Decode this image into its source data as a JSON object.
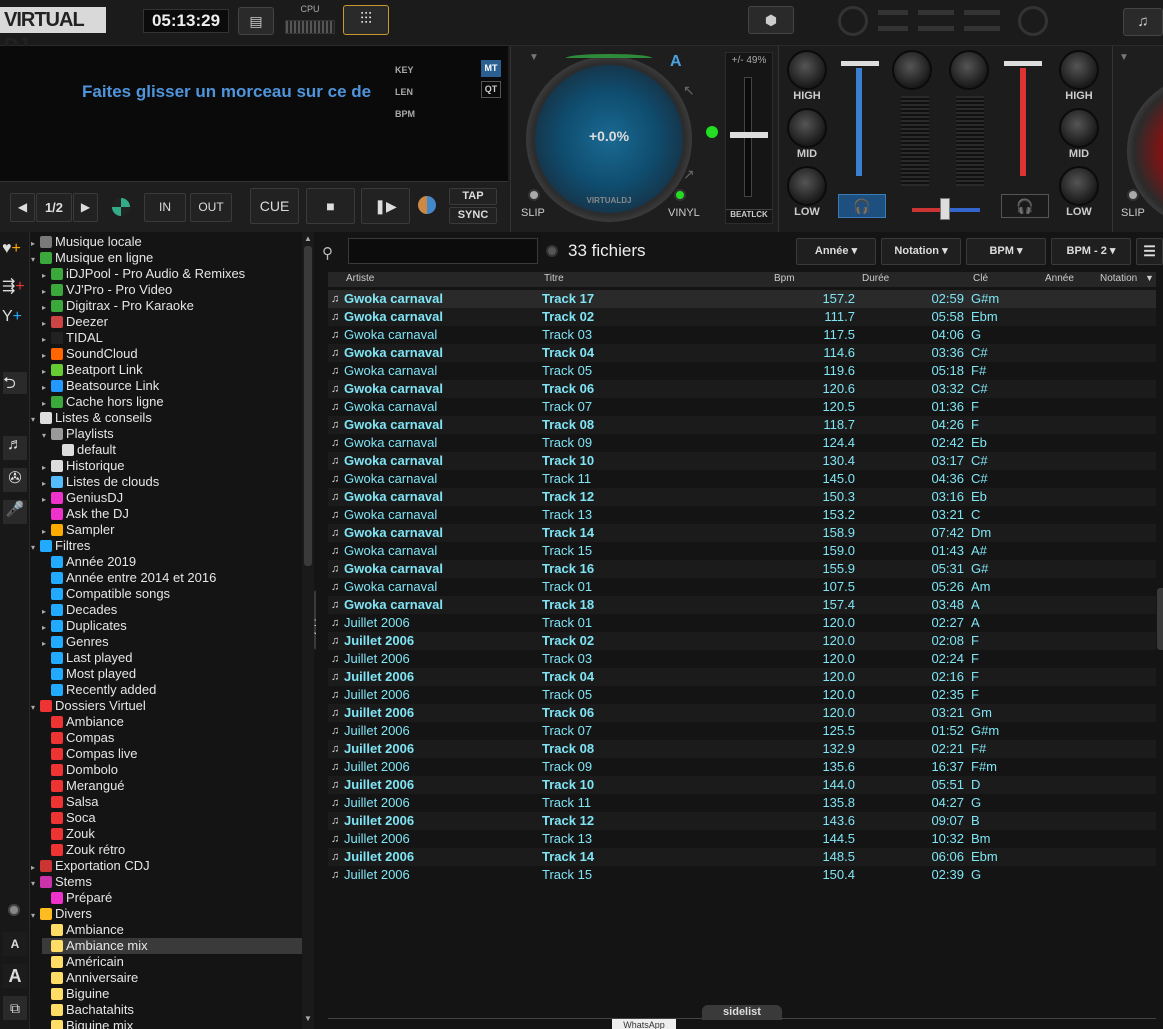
{
  "topbar": {
    "logo": "VIRTUAL DJ",
    "clock": "05:13:29",
    "cpu_label": "CPU"
  },
  "deckA": {
    "drop_message": "Faites glisser un morceau sur ce de",
    "key_label": "KEY",
    "len_label": "LEN",
    "bpm_label": "BPM",
    "mt": "MT",
    "qt": "QT",
    "page": "1/2",
    "in": "IN",
    "out": "OUT",
    "cue": "CUE",
    "tap": "TAP",
    "sync": "SYNC",
    "pitch": "+0.0%",
    "deck_letter": "A",
    "slip": "SLIP",
    "vinyl": "VINYL",
    "range": "+/- 49%",
    "beatlock": "BEATLCK",
    "brand": "VIRTUALDJ"
  },
  "mixer": {
    "high": "HIGH",
    "mid": "MID",
    "low": "LOW"
  },
  "deckB": {
    "slip": "SLIP"
  },
  "tree": [
    {
      "label": "Musique locale",
      "indent": 0,
      "arrow": "▸",
      "icon": "#7a7a7a"
    },
    {
      "label": "Musique en ligne",
      "indent": 0,
      "arrow": "▾",
      "icon": "#3aa83a"
    },
    {
      "label": "iDJPool - Pro Audio & Remixes",
      "indent": 1,
      "arrow": "▸",
      "icon": "#3aa83a"
    },
    {
      "label": "VJ'Pro - Pro Video",
      "indent": 1,
      "arrow": "▸",
      "icon": "#3aa83a"
    },
    {
      "label": "Digitrax - Pro Karaoke",
      "indent": 1,
      "arrow": "▸",
      "icon": "#3aa83a"
    },
    {
      "label": "Deezer",
      "indent": 1,
      "arrow": "▸",
      "icon": "#c44"
    },
    {
      "label": "TIDAL",
      "indent": 1,
      "arrow": "▸",
      "icon": "#222"
    },
    {
      "label": "SoundCloud",
      "indent": 1,
      "arrow": "▸",
      "icon": "#f60"
    },
    {
      "label": "Beatport Link",
      "indent": 1,
      "arrow": "▸",
      "icon": "#6c3"
    },
    {
      "label": "Beatsource Link",
      "indent": 1,
      "arrow": "▸",
      "icon": "#29f"
    },
    {
      "label": "Cache hors ligne",
      "indent": 1,
      "arrow": "▸",
      "icon": "#3aa83a"
    },
    {
      "label": "Listes & conseils",
      "indent": 0,
      "arrow": "▾",
      "icon": "#ddd"
    },
    {
      "label": "Playlists",
      "indent": 1,
      "arrow": "▾",
      "icon": "#999"
    },
    {
      "label": "default",
      "indent": 2,
      "arrow": "",
      "icon": "#ddd"
    },
    {
      "label": "Historique",
      "indent": 1,
      "arrow": "▸",
      "icon": "#ddd"
    },
    {
      "label": "Listes de clouds",
      "indent": 1,
      "arrow": "▸",
      "icon": "#5bf"
    },
    {
      "label": "GeniusDJ",
      "indent": 1,
      "arrow": "▸",
      "icon": "#e3c"
    },
    {
      "label": "Ask the DJ",
      "indent": 1,
      "arrow": "",
      "icon": "#e3c"
    },
    {
      "label": "Sampler",
      "indent": 1,
      "arrow": "▸",
      "icon": "#fa0"
    },
    {
      "label": "Filtres",
      "indent": 0,
      "arrow": "▾",
      "icon": "#2af"
    },
    {
      "label": "Année 2019",
      "indent": 1,
      "arrow": "",
      "icon": "#2af"
    },
    {
      "label": "Année entre 2014 et 2016",
      "indent": 1,
      "arrow": "",
      "icon": "#2af"
    },
    {
      "label": "Compatible songs",
      "indent": 1,
      "arrow": "",
      "icon": "#2af"
    },
    {
      "label": "Decades",
      "indent": 1,
      "arrow": "▸",
      "icon": "#2af"
    },
    {
      "label": "Duplicates",
      "indent": 1,
      "arrow": "▸",
      "icon": "#2af"
    },
    {
      "label": "Genres",
      "indent": 1,
      "arrow": "▸",
      "icon": "#2af"
    },
    {
      "label": "Last played",
      "indent": 1,
      "arrow": "",
      "icon": "#2af"
    },
    {
      "label": "Most played",
      "indent": 1,
      "arrow": "",
      "icon": "#2af"
    },
    {
      "label": "Recently added",
      "indent": 1,
      "arrow": "",
      "icon": "#2af"
    },
    {
      "label": "Dossiers Virtuel",
      "indent": 0,
      "arrow": "▾",
      "icon": "#e33"
    },
    {
      "label": "Ambiance",
      "indent": 1,
      "arrow": "",
      "icon": "#e33"
    },
    {
      "label": "Compas",
      "indent": 1,
      "arrow": "",
      "icon": "#e33"
    },
    {
      "label": "Compas live",
      "indent": 1,
      "arrow": "",
      "icon": "#e33"
    },
    {
      "label": "Dombolo",
      "indent": 1,
      "arrow": "",
      "icon": "#e33"
    },
    {
      "label": "Merangué",
      "indent": 1,
      "arrow": "",
      "icon": "#e33"
    },
    {
      "label": "Salsa",
      "indent": 1,
      "arrow": "",
      "icon": "#e33"
    },
    {
      "label": "Soca",
      "indent": 1,
      "arrow": "",
      "icon": "#e33"
    },
    {
      "label": "Zouk",
      "indent": 1,
      "arrow": "",
      "icon": "#e33"
    },
    {
      "label": "Zouk rétro",
      "indent": 1,
      "arrow": "",
      "icon": "#e33"
    },
    {
      "label": "Exportation CDJ",
      "indent": 0,
      "arrow": "▸",
      "icon": "#c33"
    },
    {
      "label": "Stems",
      "indent": 0,
      "arrow": "▾",
      "icon": "#c3a"
    },
    {
      "label": "Préparé",
      "indent": 1,
      "arrow": "",
      "icon": "#e3c"
    },
    {
      "label": "Divers",
      "indent": 0,
      "arrow": "▾",
      "icon": "#fb2"
    },
    {
      "label": "Ambiance",
      "indent": 1,
      "arrow": "",
      "icon": "#fd6"
    },
    {
      "label": "Ambiance mix",
      "indent": 1,
      "arrow": "",
      "icon": "#fd6",
      "selected": true
    },
    {
      "label": "Américain",
      "indent": 1,
      "arrow": "",
      "icon": "#fd6"
    },
    {
      "label": "Anniversaire",
      "indent": 1,
      "arrow": "",
      "icon": "#fd6"
    },
    {
      "label": "Biguine",
      "indent": 1,
      "arrow": "",
      "icon": "#fd6"
    },
    {
      "label": "Bachatahits",
      "indent": 1,
      "arrow": "",
      "icon": "#fd6"
    },
    {
      "label": "Biguine mix",
      "indent": 1,
      "arrow": "",
      "icon": "#fd6"
    }
  ],
  "browser": {
    "file_count": "33 fichiers",
    "sort_buttons": [
      "Année",
      "Notation",
      "BPM",
      "BPM - 2"
    ],
    "headers": {
      "artist": "Artiste",
      "title": "Titre",
      "bpm": "Bpm",
      "duration": "Durée",
      "key": "Clé",
      "year": "Année",
      "rating": "Notation"
    },
    "folders_tab": "folders",
    "sidelist_tab": "sidelist",
    "rows": [
      [
        "Gwoka carnaval",
        "Track 17",
        "157.2",
        "02:59",
        "G#m"
      ],
      [
        "Gwoka carnaval",
        "Track 02",
        "111.7",
        "05:58",
        "Ebm"
      ],
      [
        "Gwoka carnaval",
        "Track 03",
        "117.5",
        "04:06",
        "G"
      ],
      [
        "Gwoka carnaval",
        "Track 04",
        "114.6",
        "03:36",
        "C#"
      ],
      [
        "Gwoka carnaval",
        "Track 05",
        "119.6",
        "05:18",
        "F#"
      ],
      [
        "Gwoka carnaval",
        "Track 06",
        "120.6",
        "03:32",
        "C#"
      ],
      [
        "Gwoka carnaval",
        "Track 07",
        "120.5",
        "01:36",
        "F"
      ],
      [
        "Gwoka carnaval",
        "Track 08",
        "118.7",
        "04:26",
        "F"
      ],
      [
        "Gwoka carnaval",
        "Track 09",
        "124.4",
        "02:42",
        "Eb"
      ],
      [
        "Gwoka carnaval",
        "Track 10",
        "130.4",
        "03:17",
        "C#"
      ],
      [
        "Gwoka carnaval",
        "Track 11",
        "145.0",
        "04:36",
        "C#"
      ],
      [
        "Gwoka carnaval",
        "Track 12",
        "150.3",
        "03:16",
        "Eb"
      ],
      [
        "Gwoka carnaval",
        "Track 13",
        "153.2",
        "03:21",
        "C"
      ],
      [
        "Gwoka carnaval",
        "Track 14",
        "158.9",
        "07:42",
        "Dm"
      ],
      [
        "Gwoka carnaval",
        "Track 15",
        "159.0",
        "01:43",
        "A#"
      ],
      [
        "Gwoka carnaval",
        "Track 16",
        "155.9",
        "05:31",
        "G#"
      ],
      [
        "Gwoka carnaval",
        "Track 01",
        "107.5",
        "05:26",
        "Am"
      ],
      [
        "Gwoka carnaval",
        "Track 18",
        "157.4",
        "03:48",
        "A"
      ],
      [
        "Juillet 2006",
        "Track 01",
        "120.0",
        "02:27",
        "A"
      ],
      [
        "Juillet 2006",
        "Track 02",
        "120.0",
        "02:08",
        "F"
      ],
      [
        "Juillet 2006",
        "Track 03",
        "120.0",
        "02:24",
        "F"
      ],
      [
        "Juillet 2006",
        "Track 04",
        "120.0",
        "02:16",
        "F"
      ],
      [
        "Juillet 2006",
        "Track 05",
        "120.0",
        "02:35",
        "F"
      ],
      [
        "Juillet 2006",
        "Track 06",
        "120.0",
        "03:21",
        "Gm"
      ],
      [
        "Juillet 2006",
        "Track 07",
        "125.5",
        "01:52",
        "G#m"
      ],
      [
        "Juillet 2006",
        "Track 08",
        "132.9",
        "02:21",
        "F#"
      ],
      [
        "Juillet 2006",
        "Track 09",
        "135.6",
        "16:37",
        "F#m"
      ],
      [
        "Juillet 2006",
        "Track 10",
        "144.0",
        "05:51",
        "D"
      ],
      [
        "Juillet 2006",
        "Track 11",
        "135.8",
        "04:27",
        "G"
      ],
      [
        "Juillet 2006",
        "Track 12",
        "143.6",
        "09:07",
        "B"
      ],
      [
        "Juillet 2006",
        "Track 13",
        "144.5",
        "10:32",
        "Bm"
      ],
      [
        "Juillet 2006",
        "Track 14",
        "148.5",
        "06:06",
        "Ebm"
      ],
      [
        "Juillet 2006",
        "Track 15",
        "150.4",
        "02:39",
        "G"
      ]
    ]
  },
  "taskbar_tooltip": "WhatsApp"
}
